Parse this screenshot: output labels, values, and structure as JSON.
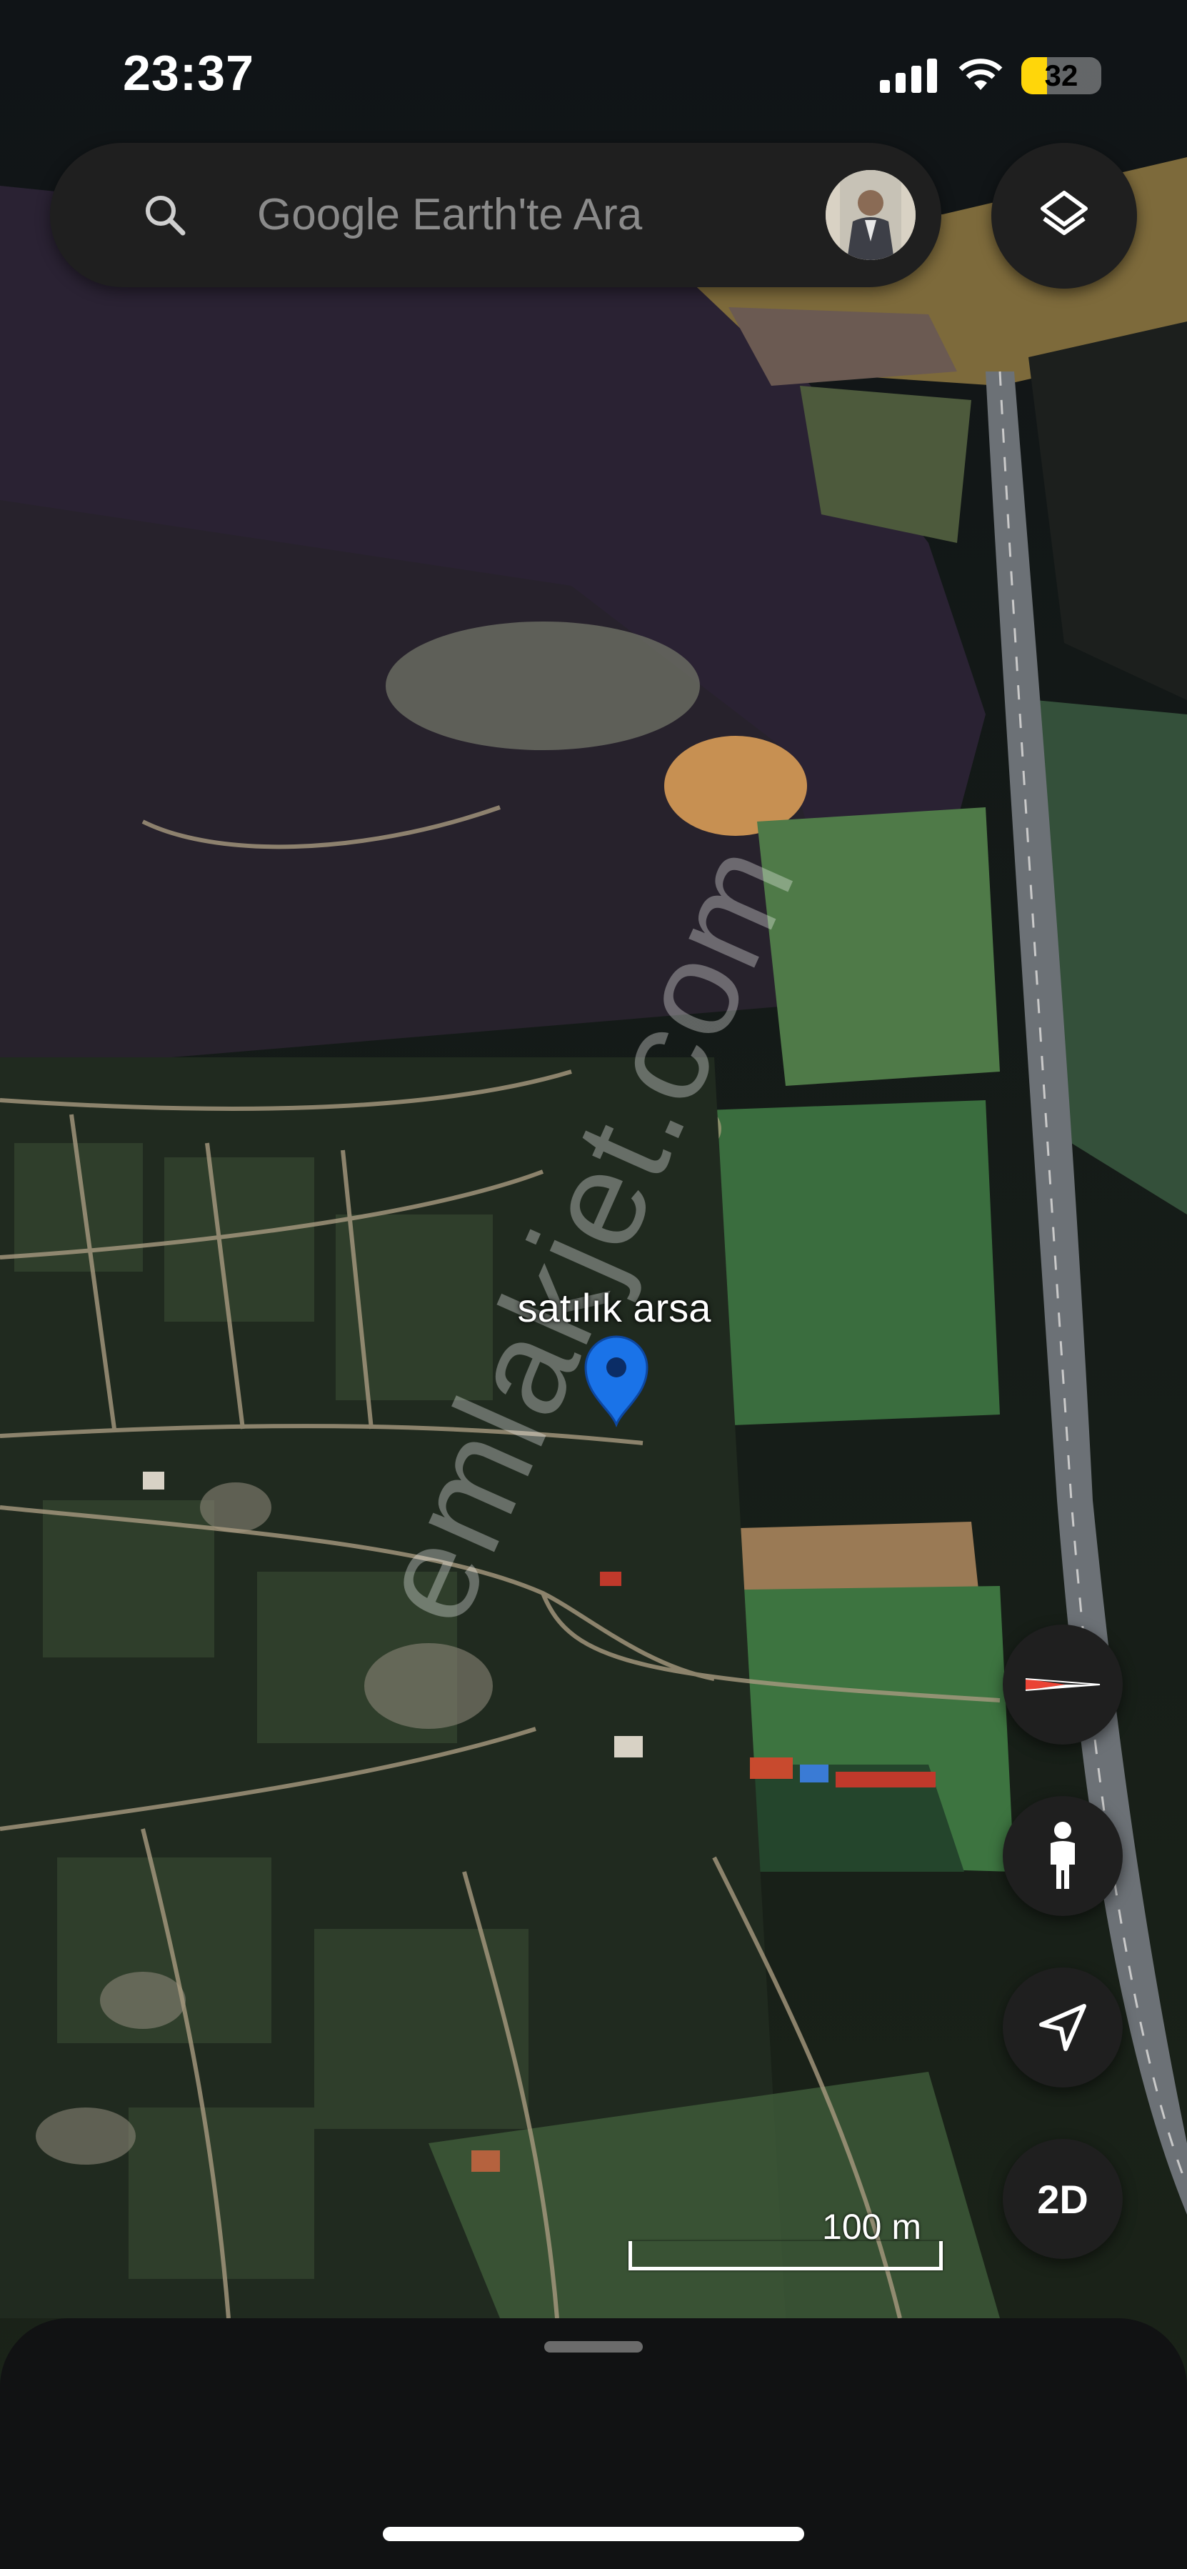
{
  "status_bar": {
    "time": "23:37",
    "battery_level": "32",
    "battery_fraction": 0.32,
    "icons": [
      "cellular-signal-icon",
      "wifi-icon",
      "battery-icon"
    ]
  },
  "search": {
    "placeholder": "Google Earth'te Ara",
    "icon": "search-icon"
  },
  "controls": {
    "layers_icon": "layers-icon",
    "compass_icon": "compass-icon",
    "street_view_icon": "pegman-icon",
    "my_location_icon": "navigation-arrow-icon",
    "view_mode_label": "2D"
  },
  "map": {
    "placemark_label": "satılık arsa",
    "scale_label": "100 m",
    "watermark": "emlakjet.com"
  },
  "colors": {
    "accent_pin": "#1a73e8",
    "control_bg": "#1f1f1f",
    "battery_fill": "#ffd60a",
    "compass_red": "#ea4335"
  }
}
